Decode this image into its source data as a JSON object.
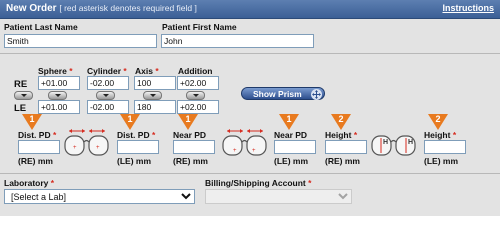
{
  "header": {
    "title": "New Order",
    "note": "[ red asterisk denotes required field ]",
    "instructions_link": "Instructions"
  },
  "patient": {
    "last_name_label": "Patient Last Name",
    "last_name_value": "Smith",
    "first_name_label": "Patient First Name",
    "first_name_value": "John"
  },
  "rx": {
    "req_mark": "*",
    "col_sphere": "Sphere",
    "col_cylinder": "Cylinder",
    "col_axis": "Axis",
    "col_addition": "Addition",
    "row_re": "RE",
    "row_le": "LE",
    "re": {
      "sphere": "+01.00",
      "cylinder": "-02.00",
      "axis": "100",
      "addition": "+02.00"
    },
    "le": {
      "sphere": "+01.00",
      "cylinder": "-02.00",
      "axis": "180",
      "addition": "+02.00"
    }
  },
  "prism_button": "Show Prism",
  "measurements": {
    "badge_1": "1",
    "badge_2": "2",
    "dist_pd_re_label": "Dist. PD",
    "dist_pd_le_label": "Dist. PD",
    "near_pd_re_label": "Near PD",
    "near_pd_le_label": "Near PD",
    "height_re_label": "Height",
    "height_le_label": "Height",
    "re_mm": "(RE) mm",
    "le_mm": "(LE) mm",
    "dist_pd_re_value": "",
    "dist_pd_le_value": "",
    "near_pd_re_value": "",
    "near_pd_le_value": "",
    "height_re_value": "",
    "height_le_value": "",
    "frame_h_glyph": "H"
  },
  "lab": {
    "laboratory_label": "Laboratory",
    "laboratory_selected": "[Select a Lab]",
    "billing_label": "Billing/Shipping Account",
    "billing_selected": ""
  },
  "icons": {
    "expand": "chevron-down-icon",
    "move": "move-arrows-icon",
    "frame": "eyeglass-frame-icon"
  },
  "colors": {
    "header_bg": "#3b5f96",
    "panel_bg": "#e3e3e3",
    "required": "#d62b1f",
    "badge": "#e87a1f",
    "button": "#2d4f8e"
  }
}
